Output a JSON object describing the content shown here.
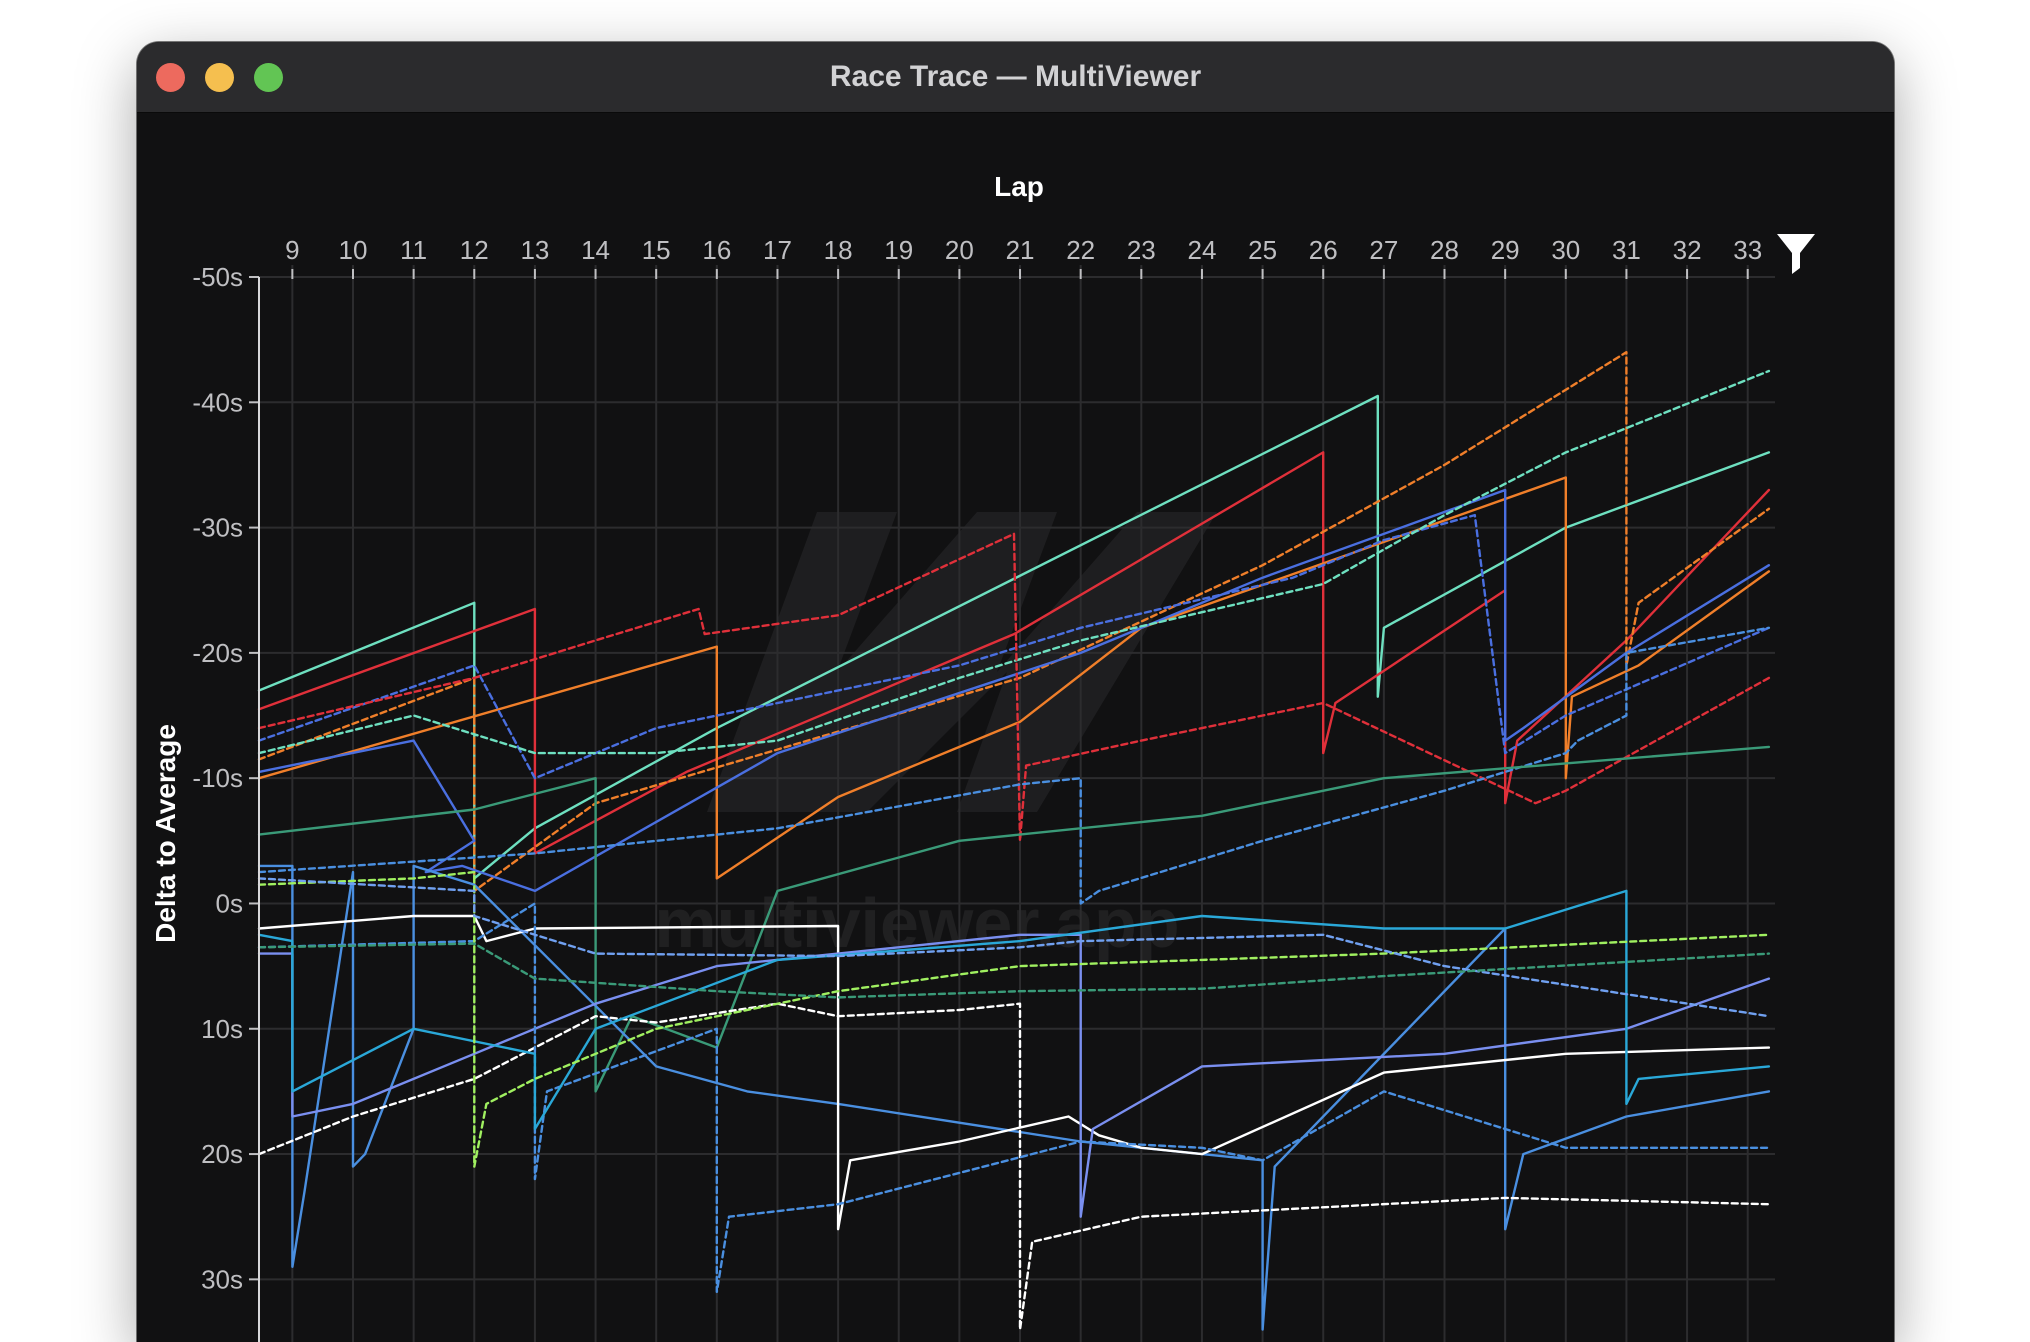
{
  "window": {
    "title": "Race Trace — MultiViewer"
  },
  "toolbar": {
    "filter_icon": "filter-icon"
  },
  "watermark": {
    "text": "multiviewer.app"
  },
  "chart_data": {
    "type": "line",
    "title": "",
    "xlabel": "Lap",
    "ylabel": "Delta to Average",
    "x_ticks": [
      9,
      10,
      11,
      12,
      13,
      14,
      15,
      16,
      17,
      18,
      19,
      20,
      21,
      22,
      23,
      24,
      25,
      26,
      27,
      28,
      29,
      30,
      31,
      32,
      33
    ],
    "y_ticks": [
      -50,
      -40,
      -30,
      -20,
      -10,
      0,
      10,
      20,
      30
    ],
    "y_tick_labels": [
      "-50s",
      "-40s",
      "-30s",
      "-20s",
      "-10s",
      "0s",
      "10s",
      "20s",
      "30s"
    ],
    "xlim": [
      8.45,
      33.45
    ],
    "ylim": [
      -50,
      35
    ],
    "y_inverted": true,
    "grid": true,
    "legend": "none",
    "series": [
      {
        "color": "#6ee0c0",
        "dashed": false,
        "points": [
          [
            8.45,
            -17
          ],
          [
            12,
            -24
          ],
          [
            12,
            -2
          ],
          [
            13,
            -6
          ],
          [
            16,
            -14
          ],
          [
            26.9,
            -40.5
          ],
          [
            26.9,
            -16.5
          ],
          [
            27,
            -22
          ],
          [
            30,
            -30
          ],
          [
            33.35,
            -36
          ]
        ]
      },
      {
        "color": "#e0303a",
        "dashed": false,
        "points": [
          [
            8.45,
            -15.5
          ],
          [
            13,
            -23.5
          ],
          [
            13,
            -4
          ],
          [
            15.5,
            -10.5
          ],
          [
            20.9,
            -21.5
          ],
          [
            26,
            -36
          ],
          [
            26,
            -12
          ],
          [
            26.2,
            -16
          ],
          [
            29,
            -25
          ],
          [
            29,
            -8
          ],
          [
            29.2,
            -13
          ],
          [
            31,
            -21
          ],
          [
            33.35,
            -33
          ]
        ]
      },
      {
        "color": "#f07f2a",
        "dashed": false,
        "points": [
          [
            8.45,
            -10
          ],
          [
            16,
            -20.5
          ],
          [
            16,
            -2
          ],
          [
            18,
            -8.5
          ],
          [
            21,
            -14.5
          ],
          [
            23,
            -22
          ],
          [
            30,
            -34
          ],
          [
            30,
            -10
          ],
          [
            30.1,
            -16.5
          ],
          [
            31.2,
            -19
          ],
          [
            33.35,
            -26.5
          ]
        ]
      },
      {
        "color": "#f07f2a",
        "dashed": true,
        "points": [
          [
            8.45,
            -11.5
          ],
          [
            12,
            -18
          ],
          [
            12,
            -1
          ],
          [
            14,
            -8
          ],
          [
            21,
            -18
          ],
          [
            25,
            -27
          ],
          [
            28,
            -35
          ],
          [
            31,
            -44
          ],
          [
            31,
            -19
          ],
          [
            31.2,
            -24
          ],
          [
            33.35,
            -31.5
          ]
        ]
      },
      {
        "color": "#4a6fe0",
        "dashed": false,
        "points": [
          [
            8.45,
            -10.5
          ],
          [
            11,
            -13
          ],
          [
            12,
            -5
          ],
          [
            11.2,
            -2.5
          ],
          [
            11.8,
            -3
          ],
          [
            13,
            -1
          ],
          [
            17,
            -12
          ],
          [
            22,
            -20
          ],
          [
            25,
            -26
          ],
          [
            29,
            -33
          ],
          [
            29,
            -13
          ],
          [
            29.3,
            -14
          ],
          [
            31,
            -20
          ],
          [
            33.35,
            -27
          ]
        ]
      },
      {
        "color": "#4a6fe0",
        "dashed": true,
        "points": [
          [
            8.45,
            -13
          ],
          [
            12,
            -19
          ],
          [
            13,
            -10
          ],
          [
            15,
            -14
          ],
          [
            20,
            -19
          ],
          [
            22,
            -22
          ],
          [
            25.5,
            -26
          ],
          [
            27,
            -29
          ],
          [
            28.5,
            -31
          ],
          [
            29,
            -12
          ],
          [
            30,
            -15
          ],
          [
            33.35,
            -22
          ]
        ]
      },
      {
        "color": "#6ee0c0",
        "dashed": true,
        "points": [
          [
            8.45,
            -12
          ],
          [
            11,
            -15
          ],
          [
            13,
            -12
          ],
          [
            15,
            -12
          ],
          [
            17,
            -13
          ],
          [
            20,
            -18
          ],
          [
            22,
            -21
          ],
          [
            26,
            -25.5
          ],
          [
            28,
            -31
          ],
          [
            30,
            -36
          ],
          [
            33.35,
            -42.5
          ]
        ]
      },
      {
        "color": "#e0303a",
        "dashed": true,
        "points": [
          [
            8.45,
            -14
          ],
          [
            12,
            -18
          ],
          [
            14,
            -21
          ],
          [
            15.7,
            -23.5
          ],
          [
            15.8,
            -21.5
          ],
          [
            18,
            -23
          ],
          [
            20.9,
            -29.5
          ],
          [
            21,
            -5
          ],
          [
            21.1,
            -11
          ],
          [
            23,
            -13
          ],
          [
            26,
            -16
          ],
          [
            29.5,
            -8
          ],
          [
            30,
            -9
          ],
          [
            33.35,
            -18
          ]
        ]
      },
      {
        "color": "#4a8fe0",
        "dashed": true,
        "points": [
          [
            8.45,
            -2.5
          ],
          [
            13,
            -4
          ],
          [
            17,
            -6
          ],
          [
            21,
            -9.5
          ],
          [
            22,
            -10
          ],
          [
            22,
            0
          ],
          [
            22.3,
            -1
          ],
          [
            25,
            -5
          ],
          [
            28,
            -9
          ],
          [
            30,
            -12
          ],
          [
            30.2,
            -13
          ],
          [
            31,
            -15
          ],
          [
            31,
            -20
          ],
          [
            33.35,
            -22
          ]
        ]
      },
      {
        "color": "#3a9a78",
        "dashed": false,
        "points": [
          [
            8.45,
            -5.5
          ],
          [
            12,
            -7.5
          ],
          [
            14,
            -10
          ],
          [
            14,
            15
          ],
          [
            14.6,
            9
          ],
          [
            16,
            11.5
          ],
          [
            17,
            -1
          ],
          [
            20,
            -5
          ],
          [
            24,
            -7
          ],
          [
            27,
            -10
          ],
          [
            33.35,
            -12.5
          ]
        ]
      },
      {
        "color": "#4a8fe0",
        "dashed": false,
        "points": [
          [
            8.45,
            -3
          ],
          [
            9,
            -3
          ],
          [
            9,
            29
          ],
          [
            9.2,
            23
          ],
          [
            10,
            -2.5
          ],
          [
            10,
            21
          ],
          [
            10.2,
            20
          ],
          [
            11,
            10
          ],
          [
            11,
            -3
          ],
          [
            12,
            -1.5
          ],
          [
            15,
            13
          ],
          [
            16.5,
            15
          ],
          [
            18,
            16
          ],
          [
            22,
            19
          ],
          [
            25,
            20.5
          ],
          [
            25,
            34
          ],
          [
            25.2,
            21
          ],
          [
            29,
            2
          ],
          [
            29,
            26
          ],
          [
            29.3,
            20
          ],
          [
            31,
            17
          ],
          [
            33.35,
            15
          ]
        ]
      },
      {
        "color": "#ffffff",
        "dashed": false,
        "points": [
          [
            8.45,
            2
          ],
          [
            11,
            1
          ],
          [
            12,
            1
          ],
          [
            12.2,
            3
          ],
          [
            13,
            2
          ],
          [
            18,
            1.8
          ],
          [
            18,
            26
          ],
          [
            18.2,
            20.5
          ],
          [
            20,
            19
          ],
          [
            21.8,
            17
          ],
          [
            22.3,
            18.5
          ],
          [
            23,
            19.5
          ],
          [
            24,
            20
          ],
          [
            27,
            13.5
          ],
          [
            30,
            12
          ],
          [
            33.35,
            11.5
          ]
        ]
      },
      {
        "color": "#ffffff",
        "dashed": true,
        "points": [
          [
            8.45,
            20
          ],
          [
            10,
            17
          ],
          [
            12,
            14
          ],
          [
            14,
            9
          ],
          [
            15,
            9.5
          ],
          [
            17,
            8
          ],
          [
            18,
            9
          ],
          [
            20,
            8.5
          ],
          [
            21,
            8
          ],
          [
            21,
            34
          ],
          [
            21.2,
            27
          ],
          [
            23,
            25
          ],
          [
            25,
            24.5
          ],
          [
            29,
            23.5
          ],
          [
            33.35,
            24
          ]
        ]
      },
      {
        "color": "#7a8ff0",
        "dashed": false,
        "points": [
          [
            8.45,
            4
          ],
          [
            9,
            4
          ],
          [
            9,
            17
          ],
          [
            10,
            16
          ],
          [
            12,
            12
          ],
          [
            14,
            8
          ],
          [
            16,
            5
          ],
          [
            18,
            4
          ],
          [
            21,
            2.5
          ],
          [
            22,
            2.5
          ],
          [
            22,
            25
          ],
          [
            22.2,
            18
          ],
          [
            24,
            13
          ],
          [
            28,
            12
          ],
          [
            31,
            10
          ],
          [
            33.35,
            6
          ]
        ]
      },
      {
        "color": "#4a8fe0",
        "dashed": true,
        "points": [
          [
            8.45,
            3.5
          ],
          [
            12,
            3
          ],
          [
            13,
            0
          ],
          [
            13,
            22
          ],
          [
            13.2,
            15
          ],
          [
            16,
            10
          ],
          [
            16,
            31
          ],
          [
            16.2,
            25
          ],
          [
            18,
            24
          ],
          [
            20,
            21.5
          ],
          [
            22,
            19
          ],
          [
            24,
            19.5
          ],
          [
            25,
            20.5
          ],
          [
            27,
            15
          ],
          [
            30,
            19.5
          ],
          [
            33.35,
            19.5
          ]
        ]
      },
      {
        "color": "#2aa8d8",
        "dashed": false,
        "points": [
          [
            8.45,
            2.5
          ],
          [
            9,
            3
          ],
          [
            9,
            15
          ],
          [
            11,
            10
          ],
          [
            13,
            12
          ],
          [
            13,
            18
          ],
          [
            14,
            10
          ],
          [
            17,
            4.5
          ],
          [
            21,
            3
          ],
          [
            24,
            1
          ],
          [
            27,
            2
          ],
          [
            29,
            2
          ],
          [
            31,
            -1
          ],
          [
            31,
            16
          ],
          [
            31.2,
            14
          ],
          [
            33.35,
            13
          ]
        ]
      },
      {
        "color": "#a0f060",
        "dashed": true,
        "points": [
          [
            8.45,
            -1.5
          ],
          [
            11,
            -2
          ],
          [
            12,
            -2.5
          ],
          [
            12,
            21
          ],
          [
            12.2,
            16
          ],
          [
            13,
            14
          ],
          [
            15,
            10
          ],
          [
            18,
            7
          ],
          [
            21,
            5
          ],
          [
            24,
            4.5
          ],
          [
            27,
            4
          ],
          [
            33.35,
            2.5
          ]
        ]
      },
      {
        "color": "#70a0f0",
        "dashed": true,
        "points": [
          [
            8.45,
            -2
          ],
          [
            12,
            -1
          ],
          [
            12,
            1
          ],
          [
            14,
            4
          ],
          [
            18,
            4.2
          ],
          [
            21,
            3.5
          ],
          [
            22,
            3
          ],
          [
            26,
            2.5
          ],
          [
            28,
            5
          ],
          [
            33.35,
            9
          ]
        ]
      },
      {
        "color": "#3a9a78",
        "dashed": true,
        "points": [
          [
            8.45,
            3.5
          ],
          [
            12,
            3.2
          ],
          [
            13,
            6
          ],
          [
            16,
            7
          ],
          [
            18,
            7.5
          ],
          [
            21,
            7
          ],
          [
            24,
            6.8
          ],
          [
            27,
            5.8
          ],
          [
            33.35,
            4
          ]
        ]
      }
    ]
  }
}
